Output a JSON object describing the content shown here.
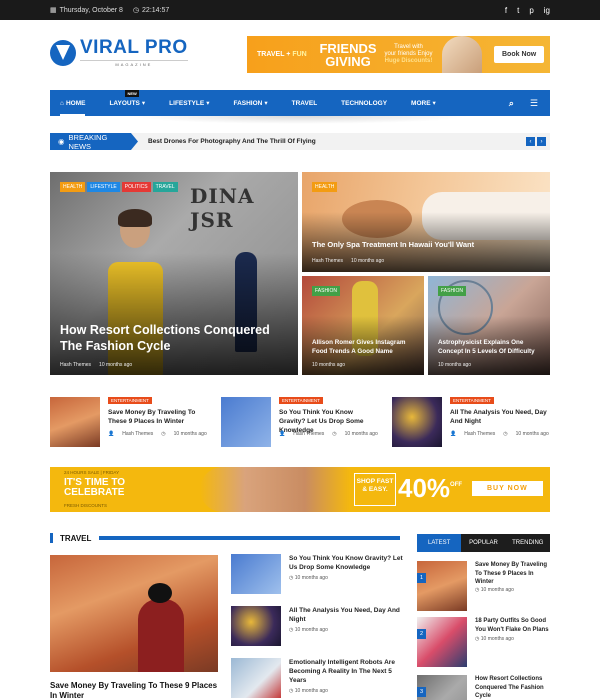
{
  "topbar": {
    "date": "Thursday, October 8",
    "time": "22:14:57",
    "social": [
      "f",
      "t",
      "p",
      "ig"
    ]
  },
  "logo": {
    "title": "VIRAL PRO",
    "subtitle": "MAGAZINE"
  },
  "top_ad": {
    "left": "TRAVEL",
    "left_plus": "FUN",
    "headline_1": "FRIENDS",
    "headline_2": "GIVING",
    "blurb_1": "Travel with",
    "blurb_2": "your friends Enjoy",
    "blurb_3": "Huge Discounts!",
    "button": "Book Now"
  },
  "nav": {
    "items": [
      {
        "label": "HOME",
        "active": true
      },
      {
        "label": "LAYOUTS",
        "badge": "NEW",
        "caret": "▾"
      },
      {
        "label": "LIFESTYLE",
        "caret": "▾"
      },
      {
        "label": "FASHION",
        "caret": "▾"
      },
      {
        "label": "TRAVEL"
      },
      {
        "label": "TECHNOLOGY"
      },
      {
        "label": "MORE",
        "caret": "▾"
      }
    ],
    "search_icon": "search-icon",
    "menu_icon": "hamburger-icon"
  },
  "breaking": {
    "label": "BREAKING NEWS",
    "headline": "Best Drones For Photography And The Thrill Of Flying"
  },
  "hero": {
    "main": {
      "tags": [
        "HEALTH",
        "LIFESTYLE",
        "POLITICS",
        "TRAVEL"
      ],
      "title": "How Resort Collections Conquered The Fashion Cycle",
      "author": "Hash Themes",
      "time": "10 months ago",
      "sign": "DINA JSR"
    },
    "top_right": {
      "tag": "HEALTH",
      "title": "The Only Spa Treatment In Hawaii You'll Want",
      "author": "Hash Themes",
      "time": "10 months ago"
    },
    "bottom_left": {
      "tag": "FASHION",
      "title": "Allison Romer Gives Instagram Food Trends A Good Name",
      "author": "Hash Themes",
      "time": "10 months ago"
    },
    "bottom_right": {
      "tag": "FASHION",
      "title": "Astrophysicist Explains One Concept In 5 Levels Of Difficulty",
      "author": "Hash Themes",
      "time": "10 months ago"
    }
  },
  "row_posts": [
    {
      "category": "ENTERTAINMENT",
      "title": "Save Money By Traveling To These 9 Places In Winter",
      "author": "Hash Themes",
      "time": "10 months ago"
    },
    {
      "category": "ENTERTAINMENT",
      "title": "So You Think You Know Gravity? Let Us Drop Some Knowledge",
      "author": "Hash Themes",
      "time": "10 months ago"
    },
    {
      "category": "ENTERTAINMENT",
      "title": "All The Analysis You Need, Day And Night",
      "author": "Hash Themes",
      "time": "10 months ago"
    }
  ],
  "mid_ad": {
    "small_top": "24 HOURS SALE | FRIDAY",
    "line1": "IT'S TIME TO",
    "line2": "CELEBRATE",
    "small_bottom": "FRESH DISCOUNTS",
    "shop": "SHOP FAST & EASY.",
    "percent": "40%",
    "off": "OFF",
    "button": "BUY NOW"
  },
  "travel": {
    "title": "TRAVEL",
    "featured_title": "Save Money By Traveling To These 9 Places In Winter",
    "list": [
      {
        "title": "So You Think You Know Gravity? Let Us Drop Some Knowledge",
        "time": "10 months ago"
      },
      {
        "title": "All The Analysis You Need, Day And Night",
        "time": "10 months ago"
      },
      {
        "title": "Emotionally Intelligent Robots Are Becoming A Reality In The Next 5 Years",
        "time": "10 months ago"
      }
    ]
  },
  "sidebar": {
    "tabs": [
      "LATEST",
      "POPULAR",
      "TRENDING"
    ],
    "items": [
      {
        "num": "1",
        "title": "Save Money By Traveling To These 9 Places In Winter",
        "time": "10 months ago"
      },
      {
        "num": "2",
        "title": "18 Party Outfits So Good You Won't Flake On Plans",
        "time": "10 months ago"
      },
      {
        "num": "3",
        "title": "How Resort Collections Conquered The Fashion Cycle",
        "time": ""
      }
    ]
  },
  "colors": {
    "brand": "#1565c0",
    "accent_orange": "#e84c1a",
    "dark": "#1a1a1a"
  }
}
